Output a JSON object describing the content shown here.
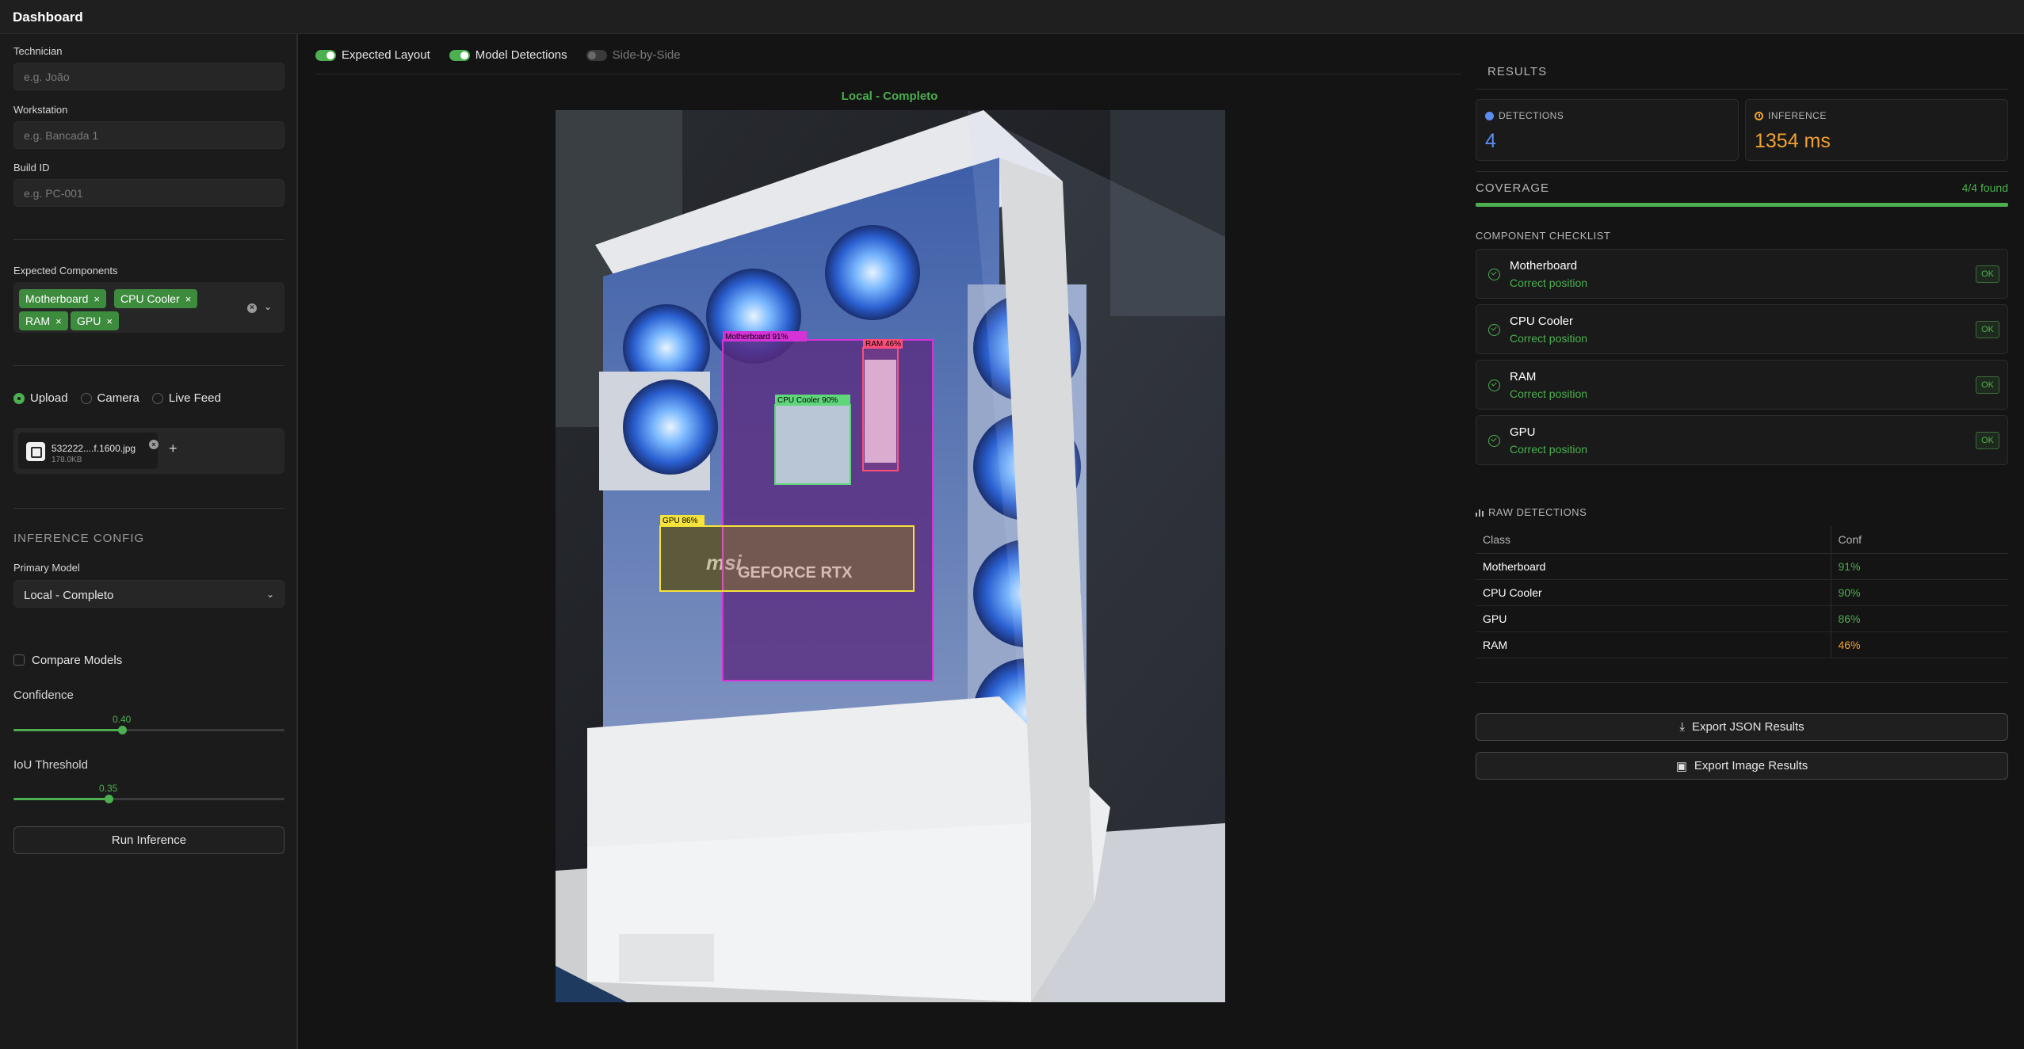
{
  "header": {
    "title": "Dashboard"
  },
  "form": {
    "technician": {
      "label": "Technician",
      "placeholder": "e.g. João"
    },
    "workstation": {
      "label": "Workstation",
      "placeholder": "e.g. Bancada 1"
    },
    "build_id": {
      "label": "Build ID",
      "placeholder": "e.g. PC-001"
    }
  },
  "expected_components": {
    "label": "Expected Components",
    "tags": [
      "Motherboard",
      "CPU Cooler",
      "RAM",
      "GPU"
    ],
    "remove_glyph": "×"
  },
  "source": {
    "options": [
      "Upload",
      "Camera",
      "Live Feed"
    ],
    "selected": "Upload"
  },
  "file": {
    "name": "532222....f.1600.jpg",
    "size": "178.0KB",
    "add_glyph": "+"
  },
  "inference_config": {
    "heading": "INFERENCE CONFIG",
    "primary_model_label": "Primary Model",
    "primary_model_value": "Local - Completo",
    "compare_label": "Compare Models",
    "compare_checked": false,
    "confidence_label": "Confidence",
    "confidence_value": "0.40",
    "confidence_fraction": 0.4,
    "iou_label": "IoU Threshold",
    "iou_value": "0.35",
    "iou_fraction": 0.35,
    "run_button": "Run Inference"
  },
  "view_toggles": [
    {
      "label": "Expected Layout",
      "on": true
    },
    {
      "label": "Model Detections",
      "on": true
    },
    {
      "label": "Side-by-Side",
      "on": false
    }
  ],
  "viewer": {
    "model_title": "Local - Completo",
    "detections": [
      {
        "label": "Motherboard 91%",
        "color": "#d633d6"
      },
      {
        "label": "RAM 46%",
        "color": "#ff4d7a"
      },
      {
        "label": "CPU Cooler 90%",
        "color": "#5fd67a"
      },
      {
        "label": "GPU 86%",
        "color": "#f5e23a"
      }
    ],
    "gpu_brand": "msi",
    "gpu_text": "GEFORCE RTX"
  },
  "results": {
    "heading": "RESULTS",
    "detections_label": "DETECTIONS",
    "detections_value": "4",
    "inference_label": "INFERENCE",
    "inference_value": "1354 ms",
    "coverage_label": "COVERAGE",
    "coverage_text": "4/4 found",
    "coverage_fraction": 1.0,
    "checklist_heading": "COMPONENT CHECKLIST",
    "checklist": [
      {
        "name": "Motherboard",
        "status": "Correct position",
        "badge": "OK"
      },
      {
        "name": "CPU Cooler",
        "status": "Correct position",
        "badge": "OK"
      },
      {
        "name": "RAM",
        "status": "Correct position",
        "badge": "OK"
      },
      {
        "name": "GPU",
        "status": "Correct position",
        "badge": "OK"
      }
    ],
    "raw_heading": "RAW DETECTIONS",
    "raw_columns": [
      "Class",
      "Conf"
    ],
    "raw_rows": [
      {
        "class": "Motherboard",
        "conf": "91%",
        "color": "#4caf50"
      },
      {
        "class": "CPU Cooler",
        "conf": "90%",
        "color": "#4caf50"
      },
      {
        "class": "GPU",
        "conf": "86%",
        "color": "#4caf50"
      },
      {
        "class": "RAM",
        "conf": "46%",
        "color": "#f0a030"
      }
    ],
    "export_json": "Export JSON Results",
    "export_image": "Export Image Results"
  },
  "colors": {
    "accent": "#4caf50",
    "warning": "#f0a030",
    "info": "#5b8def"
  }
}
